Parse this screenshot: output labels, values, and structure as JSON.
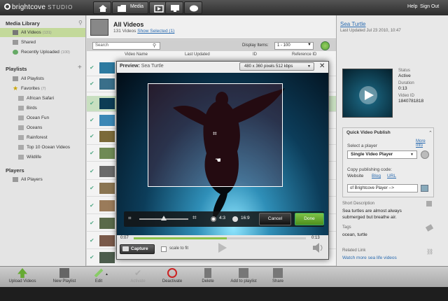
{
  "app": {
    "brand": "brightcove",
    "product": "STUDIO",
    "nav_media": "Media",
    "help": "Help",
    "signout": "Sign Out"
  },
  "sidebar": {
    "media_library": "Media Library",
    "media_items": [
      {
        "label": "All Videos",
        "count": "(131)"
      },
      {
        "label": "Shared",
        "count": ""
      },
      {
        "label": "Recently Uploaded",
        "count": "(100)"
      }
    ],
    "playlists": "Playlists",
    "all_playlists": "All Playlists",
    "favorites": {
      "label": "Favorites",
      "count": "(7)"
    },
    "favorite_items": [
      "African Safari",
      "Birds",
      "Ocean Fun",
      "Oceans",
      "Rainforest",
      "Top 10 Ocean Videos",
      "Wildlife"
    ],
    "players": "Players",
    "all_players": "All Players"
  },
  "header": {
    "title": "All Videos",
    "subtitle": "131 Videos",
    "show_selected": "Show Selected (1)"
  },
  "toolbar": {
    "search_placeholder": "Search",
    "display_items_label": "Display Items:",
    "display_items_value": "1 - 100"
  },
  "table": {
    "columns": [
      "Video Name",
      "Last Updated",
      "ID",
      "Reference ID"
    ]
  },
  "right_panel": {
    "title": "Sea Turtle",
    "updated": "Last Updated Jul 23 2010, 10:47",
    "status_label": "Status",
    "status_value": "Active",
    "duration_label": "Duration",
    "duration_value": "0:13",
    "id_label": "Video ID",
    "id_value": "1840781818",
    "qvp_title": "Quick Video Publish",
    "more_info": "More Info",
    "select_player": "Select a player",
    "player_value": "Single Video Player",
    "copy_code": "Copy publishing code:",
    "code_tabs": [
      "Website",
      "Blog",
      "URL"
    ],
    "code_value": "of Brightcove Player -->",
    "short_desc_label": "Short Description",
    "short_desc_value": "Sea turtles are almost always submerged but breathe air.",
    "tags_label": "Tags",
    "tags_value": "ocean, turtle",
    "related_label": "Related Link",
    "related_value": "Watch more sea life videos"
  },
  "bottom": {
    "left": [
      "Upload Videos",
      "New Playlist"
    ],
    "actions": [
      "Edit",
      "Activate",
      "Deactivate",
      "Delete",
      "Add to playlist",
      "Share"
    ]
  },
  "preview": {
    "title": "Preview:",
    "video_name": "Sea Turtle",
    "resolution": "480 x 360 pixels 512 kbps",
    "aspect_43": "4:3",
    "aspect_169": "16:9",
    "cancel": "Cancel",
    "done": "Done",
    "time_current": "0:07",
    "time_total": "0:13",
    "progress": 0.54,
    "capture": "Capture",
    "scale_to_fit": "scale to fit",
    "overlay_time": "0:31"
  },
  "colors": {
    "accent_green": "#6aa835",
    "link_blue": "#2a6bb0",
    "selected_row": "#c8dfc0"
  }
}
